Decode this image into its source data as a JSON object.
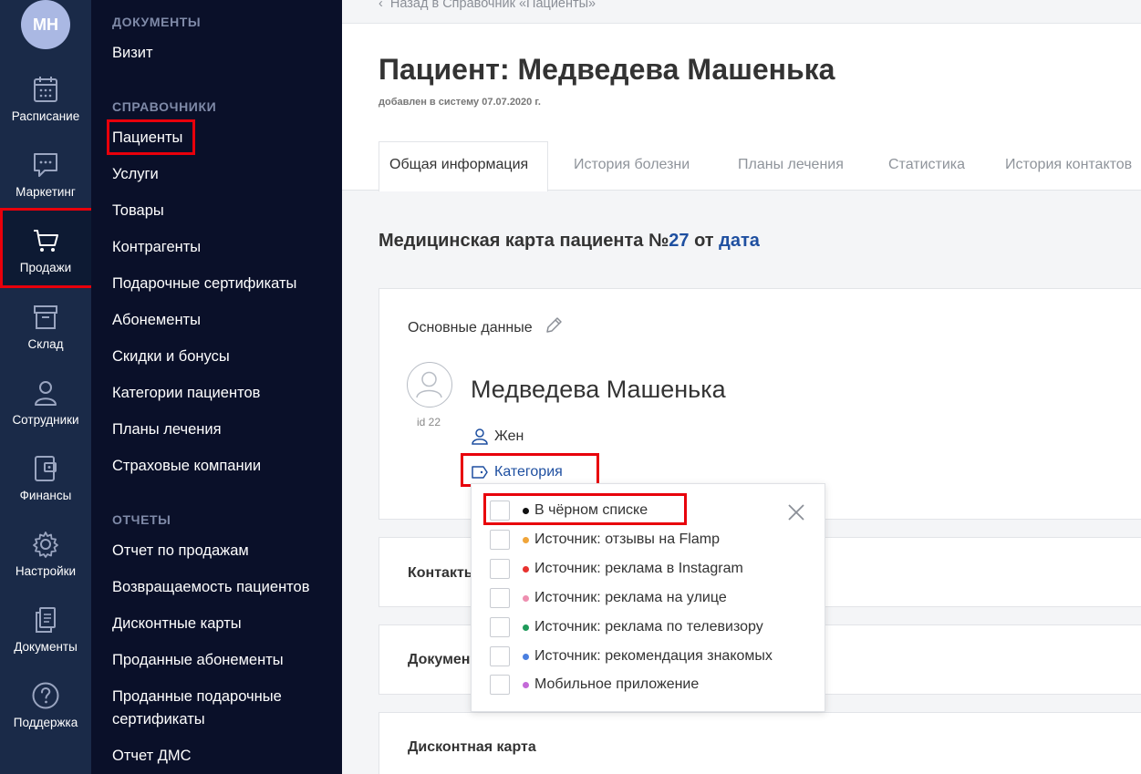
{
  "user": {
    "initials": "МН"
  },
  "rail": [
    {
      "label": "Расписание",
      "icon": "calendar-icon"
    },
    {
      "label": "Маркетинг",
      "icon": "chat-icon"
    },
    {
      "label": "Продажи",
      "icon": "cart-icon"
    },
    {
      "label": "Склад",
      "icon": "box-icon"
    },
    {
      "label": "Сотрудники",
      "icon": "person-icon"
    },
    {
      "label": "Финансы",
      "icon": "wallet-icon"
    },
    {
      "label": "Настройки",
      "icon": "gear-icon"
    },
    {
      "label": "Документы",
      "icon": "documents-icon"
    },
    {
      "label": "Поддержка",
      "icon": "question-icon"
    }
  ],
  "menu": {
    "documents_title": "ДОКУМЕНТЫ",
    "documents": [
      "Визит"
    ],
    "refs_title": "СПРАВОЧНИКИ",
    "refs": [
      "Пациенты",
      "Услуги",
      "Товары",
      "Контрагенты",
      "Подарочные сертификаты",
      "Абонементы",
      "Скидки и бонусы",
      "Категории пациентов",
      "Планы лечения",
      "Страховые компании"
    ],
    "reports_title": "ОТЧЕТЫ",
    "reports": [
      "Отчет по продажам",
      "Возвращаемость пациентов",
      "Дисконтные карты",
      "Проданные абонементы",
      "Проданные подарочные",
      "сертификаты",
      "Отчет ДМС"
    ]
  },
  "page": {
    "back_link": "Назад в Справочник «Пациенты»",
    "title": "Пациент: Медведева Машенька",
    "subtitle": "добавлен в систему 07.07.2020 г.",
    "tabs": [
      "Общая информация",
      "История болезни",
      "Планы лечения",
      "Статистика",
      "История контактов"
    ],
    "card": {
      "prefix": "Медицинская карта пациента №",
      "number": "27",
      "from": "от",
      "date_link": "дата"
    }
  },
  "basic": {
    "title": "Основные данные",
    "id_label": "id 22",
    "name": "Медведева Машенька",
    "gender": "Жен",
    "category_link": "Категория"
  },
  "sections": {
    "contacts": "Контакты",
    "documents": "Документы",
    "discount": "Дисконтная карта"
  },
  "dropdown": {
    "options": [
      {
        "label": "В чёрном списке",
        "color": "#111111"
      },
      {
        "label": "Источник: отзывы на Flamp",
        "color": "#f0a53a"
      },
      {
        "label": "Источник: реклама в Instagram",
        "color": "#e8322f"
      },
      {
        "label": "Источник: реклама на улице",
        "color": "#ee8fb0"
      },
      {
        "label": "Источник: реклама по телевизору",
        "color": "#1f9a5a"
      },
      {
        "label": "Источник: рекомендация знакомых",
        "color": "#4a7fe0"
      },
      {
        "label": "Мобильное приложение",
        "color": "#c46ad8"
      }
    ]
  },
  "colors": {
    "rail_bg": "#1a2a48",
    "menu_bg": "#0a1029",
    "accent_link": "#1e4fa0",
    "highlight": "#e8000b"
  }
}
